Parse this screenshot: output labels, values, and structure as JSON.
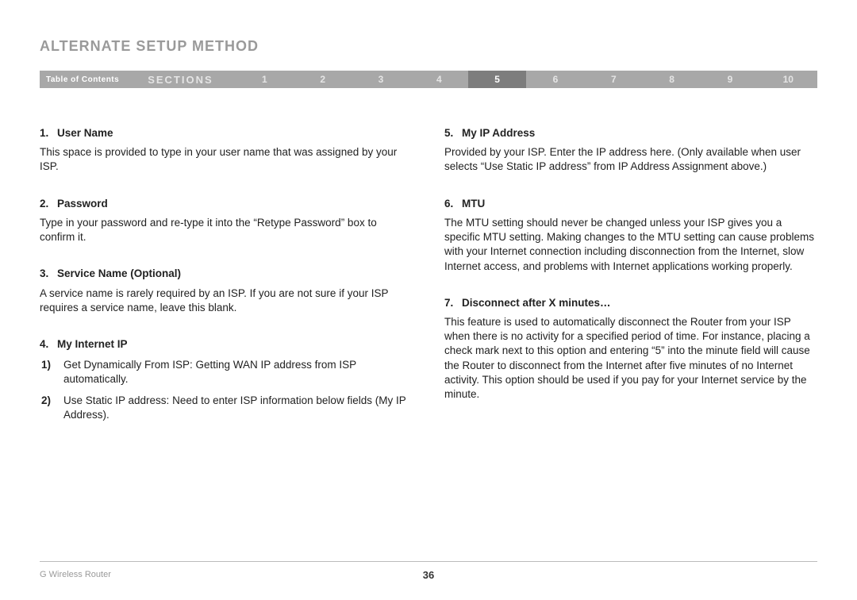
{
  "title": "ALTERNATE SETUP METHOD",
  "nav": {
    "toc": "Table of Contents",
    "sections_label": "SECTIONS",
    "sections": [
      "1",
      "2",
      "3",
      "4",
      "5",
      "6",
      "7",
      "8",
      "9",
      "10"
    ],
    "active": "5"
  },
  "left": [
    {
      "num": "1.",
      "head": "User Name",
      "body": "This space is provided to type in your user name that was assigned by your ISP."
    },
    {
      "num": "2.",
      "head": "Password",
      "body": "Type in your password and re-type it into the “Retype Password” box to confirm it."
    },
    {
      "num": "3.",
      "head": "Service Name (Optional)",
      "body": "A service name is rarely required by an ISP. If you are not sure if your ISP requires a service name, leave this blank."
    },
    {
      "num": "4.",
      "head": "My Internet IP",
      "body": "",
      "subs": [
        {
          "n": "1)",
          "t": "Get Dynamically From ISP: Getting WAN IP address from ISP automatically."
        },
        {
          "n": "2)",
          "t": "Use Static IP address: Need to enter ISP information below fields (My IP Address)."
        }
      ]
    }
  ],
  "right": [
    {
      "num": "5.",
      "head": "My IP Address",
      "body": "Provided by your ISP. Enter the IP address here. (Only available when user selects “Use Static IP address” from IP Address Assignment above.)"
    },
    {
      "num": "6.",
      "head": "MTU",
      "body": "The MTU setting should never be changed unless your ISP gives you a specific MTU setting. Making changes to the MTU setting can cause problems with your Internet connection including disconnection from the Internet, slow Internet access, and problems with Internet applications working properly."
    },
    {
      "num": "7.",
      "head": "Disconnect after X minutes…",
      "body": "This feature is used to automatically disconnect the Router from your ISP when there is no activity for a specified period of time. For instance, placing a check mark next to this option and entering “5” into the minute field will cause the Router to disconnect from the Internet after five minutes of no Internet activity. This option should be used if you pay for your Internet service by the minute."
    }
  ],
  "footer": {
    "product": "G Wireless Router",
    "page": "36"
  }
}
